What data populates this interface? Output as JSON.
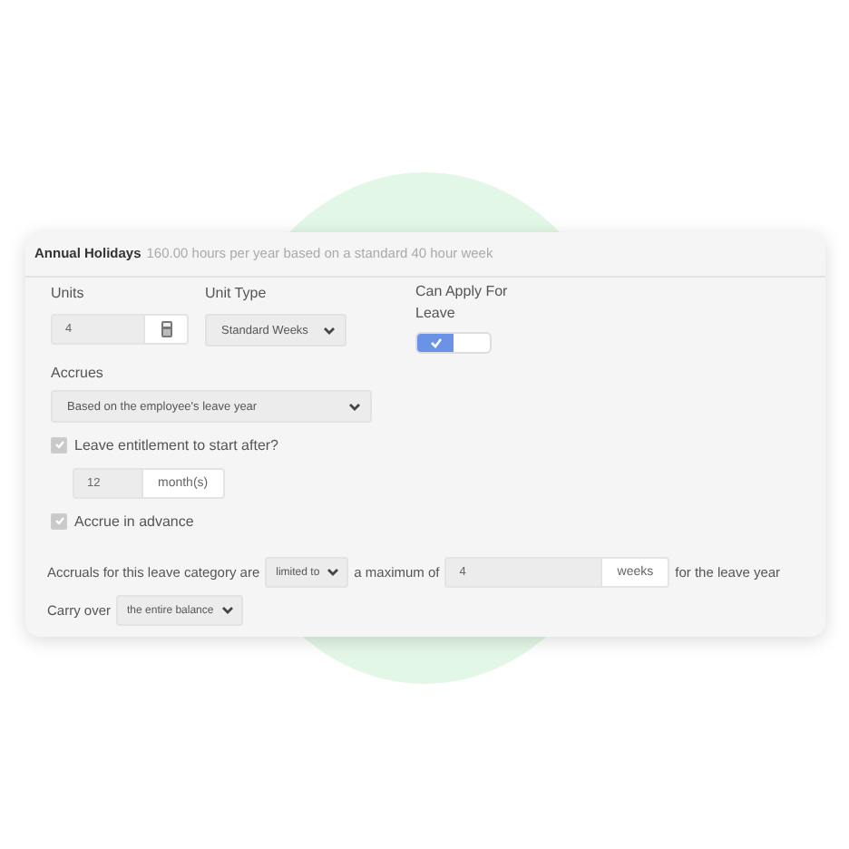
{
  "card": {
    "title": "Annual Holidays",
    "subtitle": "160.00 hours per year based on a standard 40 hour week"
  },
  "units": {
    "label": "Units",
    "value": "4"
  },
  "unit_type": {
    "label": "Unit Type",
    "value": "Standard Weeks"
  },
  "can_apply": {
    "label": "Can Apply For Leave",
    "on": true
  },
  "accrues": {
    "label": "Accrues",
    "value": "Based on the employee's leave year"
  },
  "entitlement": {
    "label": "Leave entitlement to start after?",
    "checked": true,
    "value": "12",
    "unit": "month(s)"
  },
  "advance": {
    "label": "Accrue in advance",
    "checked": true
  },
  "accruals": {
    "prefix": "Accruals for this leave category are",
    "limit": "limited to",
    "middle": "a maximum of",
    "value": "4",
    "unit": "weeks",
    "suffix": "for the leave year"
  },
  "carry_over": {
    "label": "Carry over",
    "value": "the entire balance"
  }
}
